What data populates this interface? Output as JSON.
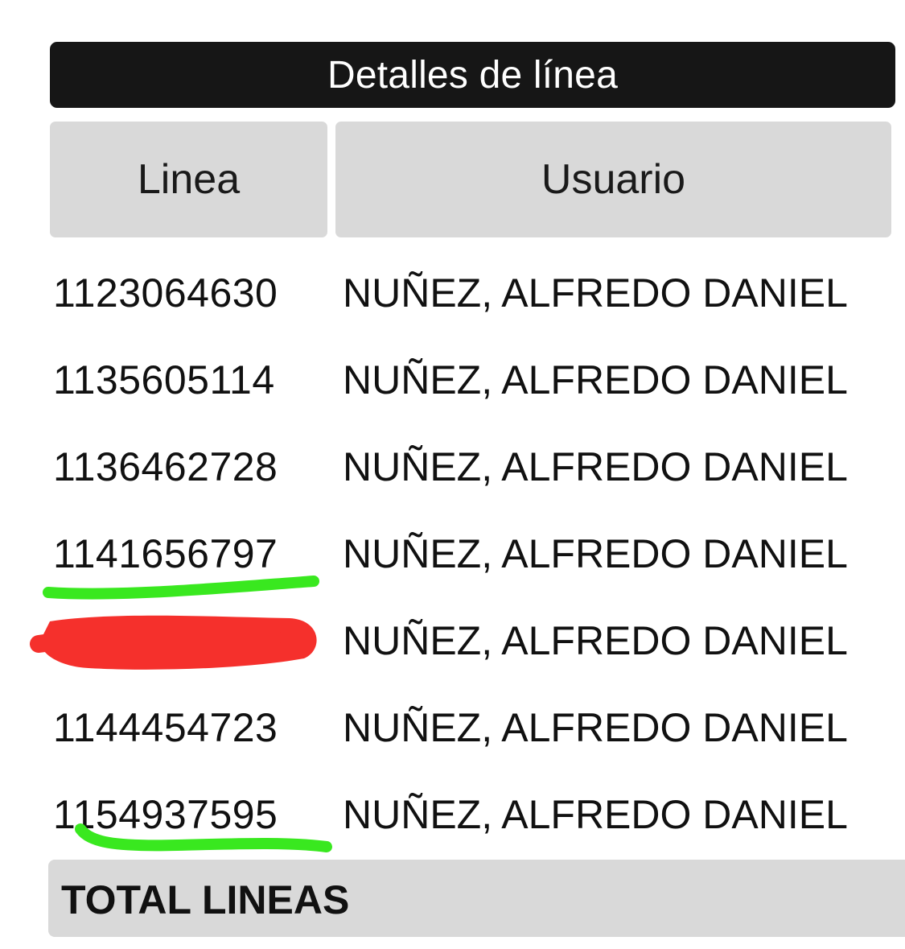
{
  "title": "Detalles de línea",
  "table": {
    "columns": [
      "Linea",
      "Usuario"
    ],
    "rows": [
      {
        "linea": "1123064630",
        "usuario": "NUÑEZ, ALFREDO DANIEL"
      },
      {
        "linea": "1135605114",
        "usuario": "NUÑEZ, ALFREDO DANIEL"
      },
      {
        "linea": "1136462728",
        "usuario": "NUÑEZ, ALFREDO DANIEL"
      },
      {
        "linea": "1141656797",
        "usuario": "NUÑEZ, ALFREDO DANIEL"
      },
      {
        "linea": "",
        "usuario": "NUÑEZ, ALFREDO DANIEL"
      },
      {
        "linea": "1144454723",
        "usuario": "NUÑEZ, ALFREDO DANIEL"
      },
      {
        "linea": "1154937595",
        "usuario": "NUÑEZ, ALFREDO DANIEL"
      }
    ]
  },
  "total": {
    "label": "TOTAL LINEAS"
  },
  "colors": {
    "title_bg": "#161616",
    "header_bg": "#d9d9d9",
    "highlight_green": "#39e81f",
    "redaction_red": "#f5302c"
  }
}
